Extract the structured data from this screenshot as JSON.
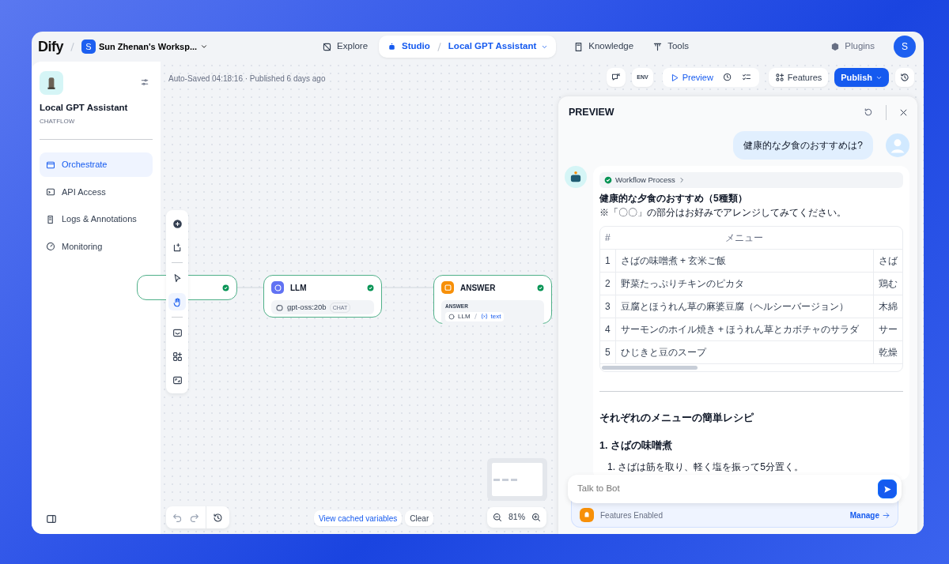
{
  "nav": {
    "logo": "Dify",
    "workspace_initial": "S",
    "workspace": "Sun Zhenan's Worksp...",
    "items": [
      {
        "label": "Explore",
        "selected": false
      },
      {
        "label": "Studio",
        "selected": true,
        "app": "Local GPT Assistant"
      },
      {
        "label": "Knowledge",
        "selected": false
      },
      {
        "label": "Tools",
        "selected": false
      }
    ],
    "plugins": "Plugins",
    "avatar": "S"
  },
  "sidebar": {
    "app_name": "Local GPT Assistant",
    "app_type": "CHATFLOW",
    "items": [
      {
        "label": "Orchestrate",
        "selected": true
      },
      {
        "label": "API Access",
        "selected": false
      },
      {
        "label": "Logs & Annotations",
        "selected": false
      },
      {
        "label": "Monitoring",
        "selected": false
      }
    ]
  },
  "canvas": {
    "status": "Auto-Saved 04:18:16 · Published 6 days ago",
    "toolbar": {
      "env": "ENV",
      "preview": "Preview",
      "features": "Features",
      "publish": "Publish"
    },
    "nodes": [
      {
        "kind": "start"
      },
      {
        "kind": "llm",
        "title": "LLM",
        "model": "gpt-oss:20b",
        "mode": "CHAT"
      },
      {
        "kind": "answer",
        "title": "ANSWER",
        "label": "ANSWER",
        "source": "LLM",
        "variable": "text"
      }
    ],
    "cached": "View cached variables",
    "clear": "Clear",
    "zoom": "81%"
  },
  "preview": {
    "title": "PREVIEW",
    "question": "健康的な夕食のおすすめは?",
    "process": "Workflow Process",
    "heading": "健康的な夕食のおすすめ（5種類）",
    "note": "※「〇〇」の部分はお好みでアレンジしてみてください。",
    "table": {
      "columns": [
        "#",
        "メニュー"
      ],
      "rows": [
        [
          "1",
          "さばの味噌煮 + 玄米ご飯",
          "さば"
        ],
        [
          "2",
          "野菜たっぷりチキンのピカタ",
          "鶏む"
        ],
        [
          "3",
          "豆腐とほうれん草の麻婆豆腐（ヘルシーバージョン）",
          "木綿"
        ],
        [
          "4",
          "サーモンのホイル焼き + ほうれん草とカボチャのサラダ",
          "サー"
        ],
        [
          "5",
          "ひじきと豆のスープ",
          "乾燥"
        ]
      ]
    },
    "section": "それぞれのメニューの簡単レシピ",
    "subheading": "1. さばの味噌煮",
    "steps": [
      "1. さばは筋を取り、軽く塩を振って5分置く。"
    ],
    "placeholder": "Talk to Bot",
    "features": "Features Enabled",
    "manage": "Manage"
  }
}
